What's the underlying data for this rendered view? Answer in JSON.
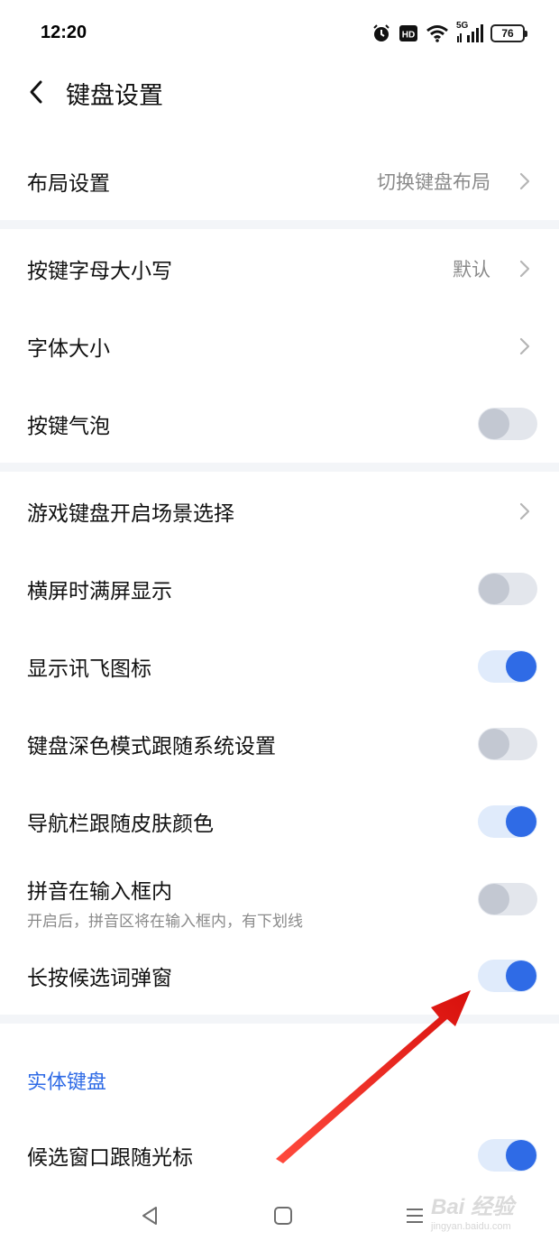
{
  "status_bar": {
    "time": "12:20",
    "network": "5G",
    "hd": "HD",
    "battery": "76",
    "icons": [
      "alarm-icon",
      "hd-icon",
      "wifi-icon",
      "signal-icon",
      "battery-icon"
    ]
  },
  "header": {
    "title": "键盘设置",
    "back_icon": "back-arrow-icon"
  },
  "settings": {
    "layout": {
      "label": "布局设置",
      "value": "切换键盘布局"
    },
    "key_case": {
      "label": "按键字母大小写",
      "value": "默认"
    },
    "font_size": {
      "label": "字体大小"
    },
    "key_bubble": {
      "label": "按键气泡",
      "enabled": false
    },
    "game_keyboard": {
      "label": "游戏键盘开启场景选择"
    },
    "landscape_fullscreen": {
      "label": "横屏时满屏显示",
      "enabled": false
    },
    "show_xunfei_icon": {
      "label": "显示讯飞图标",
      "enabled": true
    },
    "dark_mode_follow": {
      "label": "键盘深色模式跟随系统设置",
      "enabled": false
    },
    "navbar_follow_skin": {
      "label": "导航栏跟随皮肤颜色",
      "enabled": true
    },
    "pinyin_in_input": {
      "label": "拼音在输入框内",
      "sublabel": "开启后，拼音区将在输入框内，有下划线",
      "enabled": false
    },
    "long_press_popup": {
      "label": "长按候选词弹窗",
      "enabled": true
    }
  },
  "physical_keyboard": {
    "section_title": "实体键盘",
    "candidate_follow_cursor": {
      "label": "候选窗口跟随光标",
      "enabled": true
    }
  },
  "nav_bar": {
    "buttons": [
      "back-triangle-icon",
      "home-square-icon",
      "menu-lines-icon"
    ]
  },
  "watermark": {
    "text": "Bai 经验",
    "sub": "jingyan.baidu.com"
  },
  "colors": {
    "accent": "#2f6be6",
    "toggle_off_track": "#e3e6ec",
    "toggle_off_knob": "#c3c8d2",
    "toggle_on_track": "#e0ebfb",
    "divider": "#f3f5f8",
    "annotation_arrow": "#e8231f"
  }
}
